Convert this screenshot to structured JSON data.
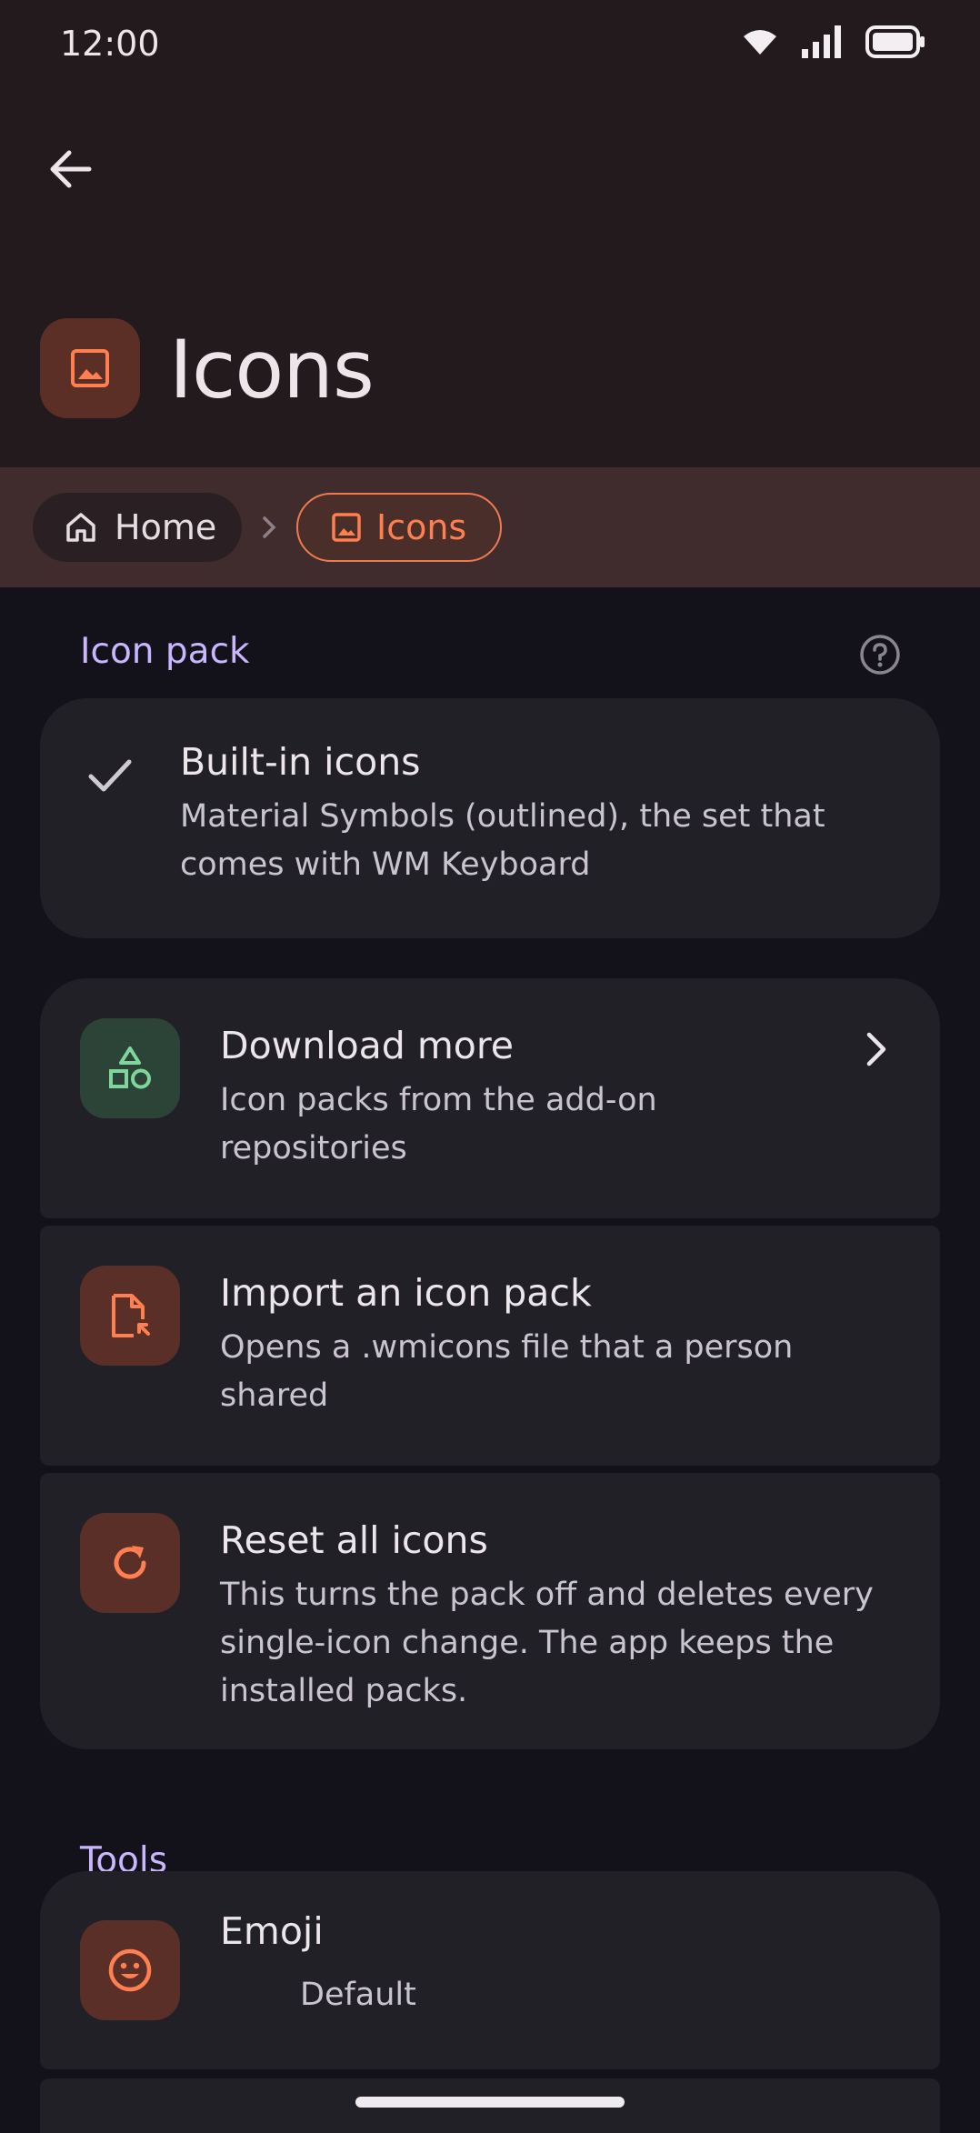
{
  "status_bar": {
    "time": "12:00"
  },
  "header": {
    "title": "Icons"
  },
  "breadcrumb": [
    {
      "label": "Home",
      "icon": "home-icon"
    },
    {
      "label": "Icons",
      "icon": "image-icon",
      "active": true
    }
  ],
  "icon_pack_section": {
    "label": "Icon pack",
    "selected_option": {
      "title": "Built-in icons",
      "subtitle_line1": "Material Symbols (outlined), the set that",
      "subtitle_line2": "comes with WM Keyboard"
    },
    "actions": [
      {
        "title": "Download more",
        "subtitle_line1": "Icon packs from the add-on",
        "subtitle_line2": "repositories",
        "icon": "shapes-icon"
      },
      {
        "title": "Import an icon pack",
        "subtitle_line1": "Opens a .wmicons file that a person",
        "subtitle_line2": "shared",
        "icon": "file-import-icon"
      },
      {
        "title": "Reset all icons",
        "subtitle_line1": "This turns the pack off and deletes every",
        "subtitle_line2": "single-icon change. The app keeps the",
        "subtitle_line3": "installed packs.",
        "icon": "refresh-icon"
      }
    ]
  },
  "tools_section": {
    "label": "Tools",
    "items": [
      {
        "title": "Emoji",
        "value": "Default",
        "icon": "emoji-icon"
      }
    ]
  },
  "colors": {
    "accent": "#ff7f50",
    "section_label": "#c9b6ff",
    "success": "#7fd69a"
  }
}
